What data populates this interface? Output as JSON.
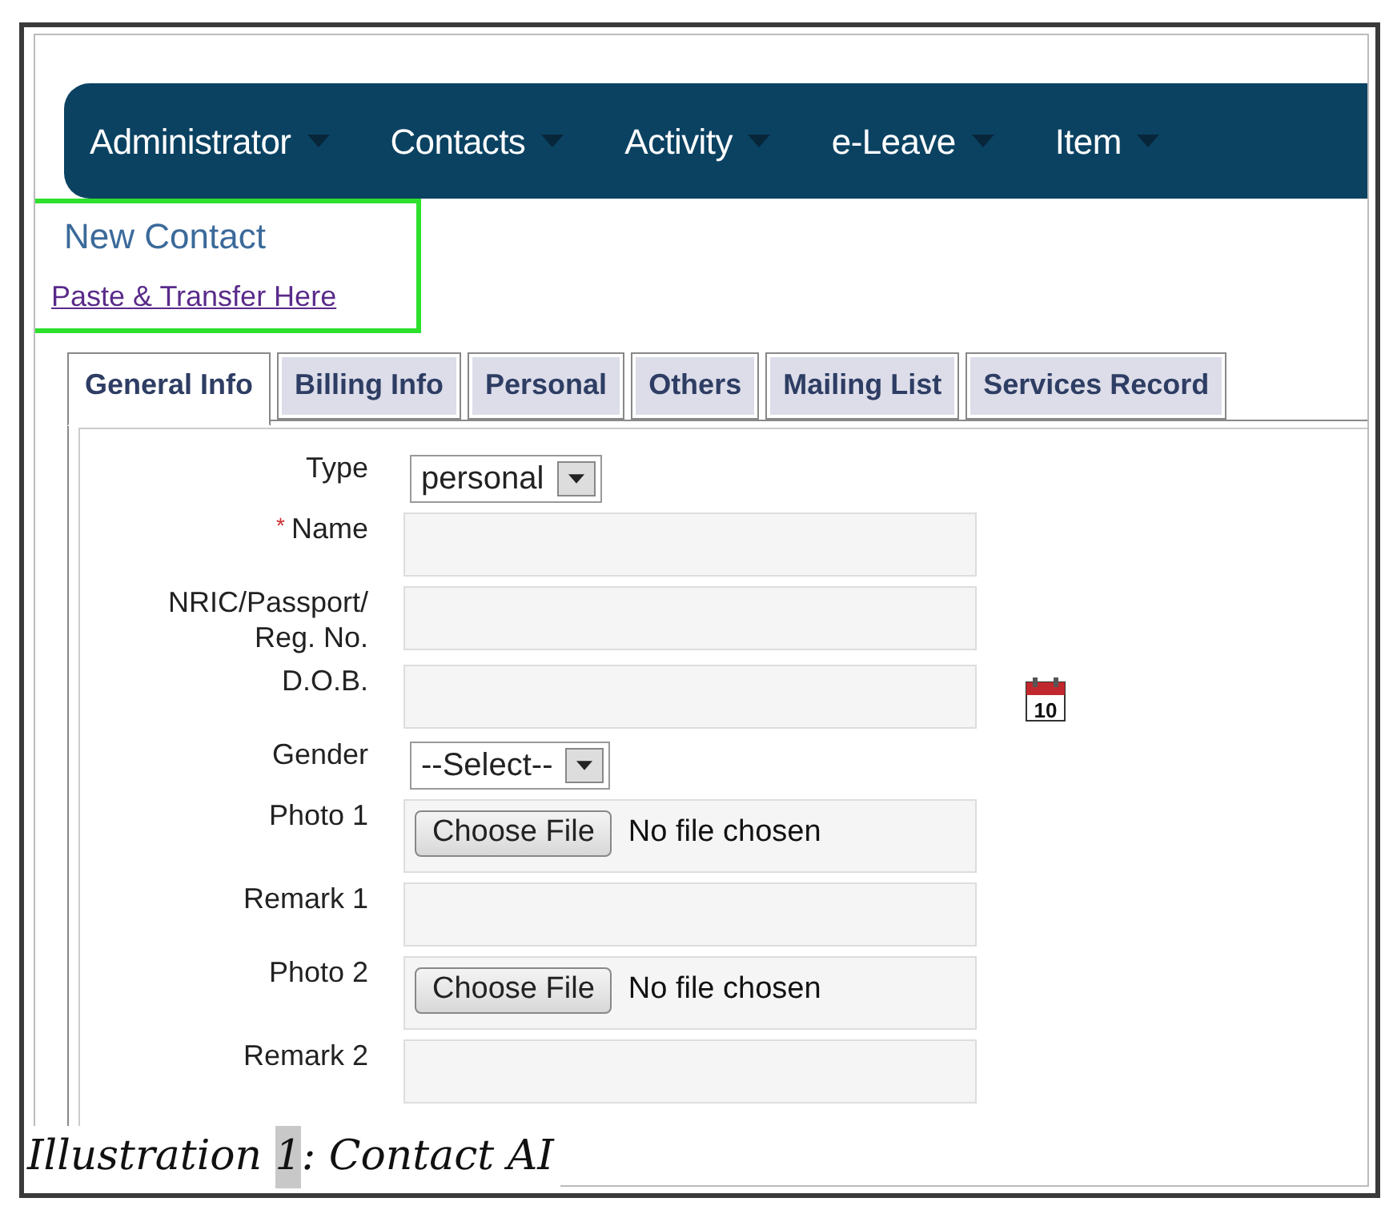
{
  "menu": [
    {
      "label": "Administrator"
    },
    {
      "label": "Contacts"
    },
    {
      "label": "Activity"
    },
    {
      "label": "e-Leave"
    },
    {
      "label": "Item"
    }
  ],
  "page_title": "New Contact",
  "highlight_link": "Paste & Transfer Here",
  "tabs": [
    {
      "label": "General Info",
      "selected": true
    },
    {
      "label": "Billing Info",
      "selected": false
    },
    {
      "label": "Personal",
      "selected": false
    },
    {
      "label": "Others",
      "selected": false
    },
    {
      "label": "Mailing List",
      "selected": false
    },
    {
      "label": "Services Record",
      "selected": false
    }
  ],
  "fields": [
    {
      "kind": "select",
      "label": "Type",
      "value": "personal"
    },
    {
      "kind": "text",
      "label": "Name",
      "required_mark": "*"
    },
    {
      "kind": "text",
      "label": "NRIC/Passport/\nReg. No."
    },
    {
      "kind": "date",
      "label": "D.O.B.",
      "icon_text": "10"
    },
    {
      "kind": "select",
      "label": "Gender",
      "value": "--Select--"
    },
    {
      "kind": "file",
      "label": "Photo 1",
      "button": "Choose File",
      "status": "No file chosen"
    },
    {
      "kind": "text",
      "label": "Remark 1"
    },
    {
      "kind": "file",
      "label": "Photo 2",
      "button": "Choose File",
      "status": "No file chosen"
    },
    {
      "kind": "text",
      "label": "Remark 2"
    }
  ],
  "caption": {
    "label": "Illustration",
    "number": "1",
    "text": ": Contact AI"
  }
}
